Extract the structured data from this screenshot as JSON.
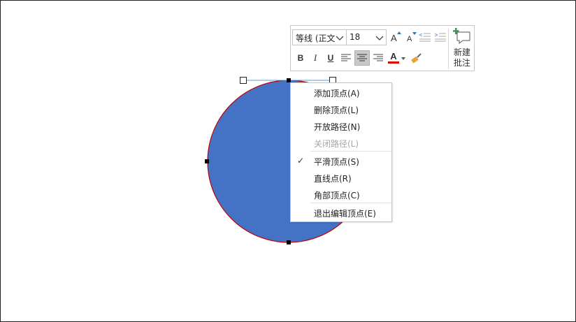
{
  "mini_toolbar": {
    "font_name": "等线 (正文",
    "font_size": "18",
    "increase_font_icon": "font-grow-icon",
    "decrease_font_icon": "font-shrink-icon",
    "bold": "B",
    "italic": "I",
    "underline": "U",
    "font_color_letter": "A",
    "font_color_hex": "#e00000",
    "new_comment_label_line1": "新建",
    "new_comment_label_line2": "批注"
  },
  "context_menu": {
    "items": [
      {
        "label": "添加顶点(A)",
        "enabled": true,
        "checked": false
      },
      {
        "label": "删除顶点(L)",
        "enabled": true,
        "checked": false
      },
      {
        "label": "开放路径(N)",
        "enabled": true,
        "checked": false
      },
      {
        "label": "关闭路径(L)",
        "enabled": false,
        "checked": false
      },
      {
        "label": "平滑顶点(S)",
        "enabled": true,
        "checked": true
      },
      {
        "label": "直线点(R)",
        "enabled": true,
        "checked": false
      },
      {
        "label": "角部顶点(C)",
        "enabled": true,
        "checked": false
      },
      {
        "label": "退出编辑顶点(E)",
        "enabled": true,
        "checked": false
      }
    ],
    "check_mark": "✓"
  },
  "shape": {
    "fill_color": "#4472c4",
    "outline_color": "#c00000"
  }
}
